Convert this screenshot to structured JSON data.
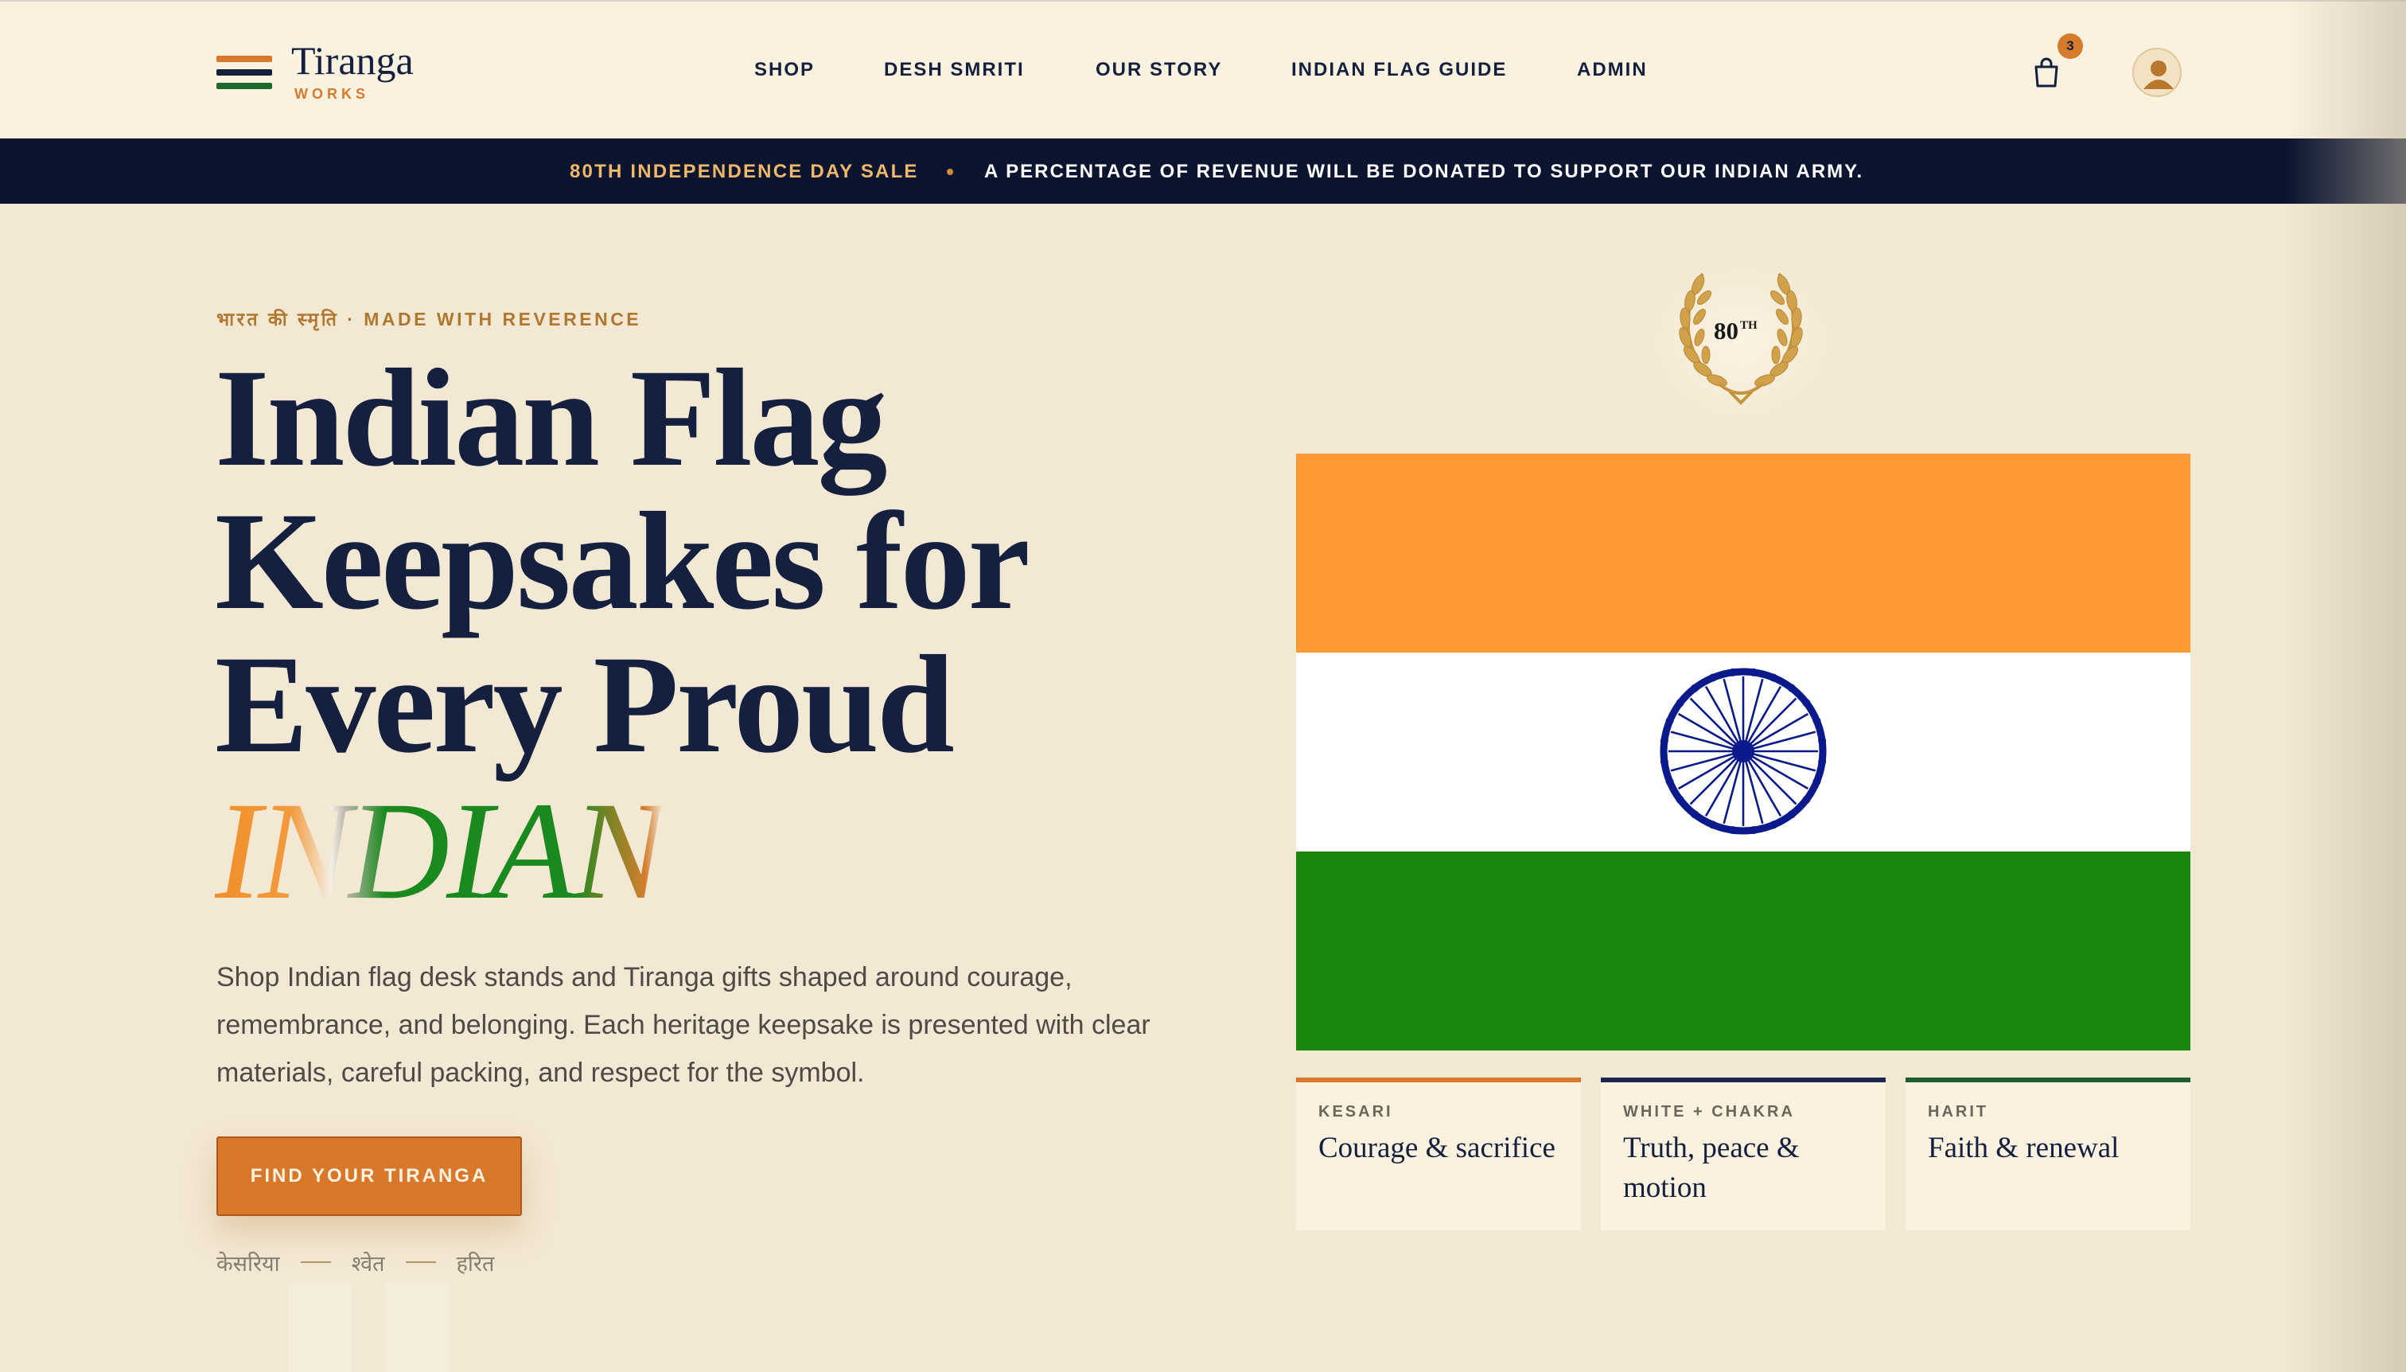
{
  "brand": {
    "title": "Tiranga",
    "subtitle": "WORKS",
    "colors": {
      "saffron": "#f7973a",
      "white": "#ffffff",
      "green": "#18870b",
      "navy": "#15203f",
      "accent": "#d9772a"
    }
  },
  "nav": {
    "items": [
      {
        "label": "SHOP"
      },
      {
        "label": "DESH SMRITI"
      },
      {
        "label": "OUR STORY"
      },
      {
        "label": "INDIAN FLAG GUIDE"
      },
      {
        "label": "ADMIN"
      }
    ],
    "cart_icon": "shopping-bag-icon",
    "cart_count": "3",
    "avatar_icon": "user-icon"
  },
  "banner": {
    "sale": "80TH INDEPENDENCE DAY SALE",
    "message": "A PERCENTAGE OF REVENUE WILL BE DONATED TO SUPPORT OUR INDIAN ARMY."
  },
  "hero": {
    "eyebrow": "भारत की स्मृति · MADE WITH REVERENCE",
    "title_lines": [
      "Indian Flag",
      "Keepsakes for",
      "Every Proud"
    ],
    "title_accent": "INDIAN",
    "description": "Shop Indian flag desk stands and Tiranga gifts shaped around courage, remembrance, and belonging. Each heritage keepsake is presented with clear materials, careful packing, and respect for the symbol.",
    "cta_label": "FIND YOUR TIRANGA",
    "tricolor_words": [
      "केसरिया",
      "श्वेत",
      "हरित"
    ]
  },
  "badge": {
    "number": "80",
    "suffix": "TH",
    "icon": "laurel-wreath-icon"
  },
  "flag": {
    "icon": "ashoka-chakra-icon",
    "bands": [
      "#fe9933",
      "#ffffff",
      "#18870b"
    ],
    "chakra_color": "#0a1a8c"
  },
  "stripes": [
    {
      "label": "KESARI",
      "text": "Courage & sacrifice",
      "color": "#d9772a"
    },
    {
      "label": "WHITE + CHAKRA",
      "text": "Truth, peace & motion",
      "color": "#1c2554"
    },
    {
      "label": "HARIT",
      "text": "Faith & renewal",
      "color": "#1d5e2c"
    }
  ]
}
